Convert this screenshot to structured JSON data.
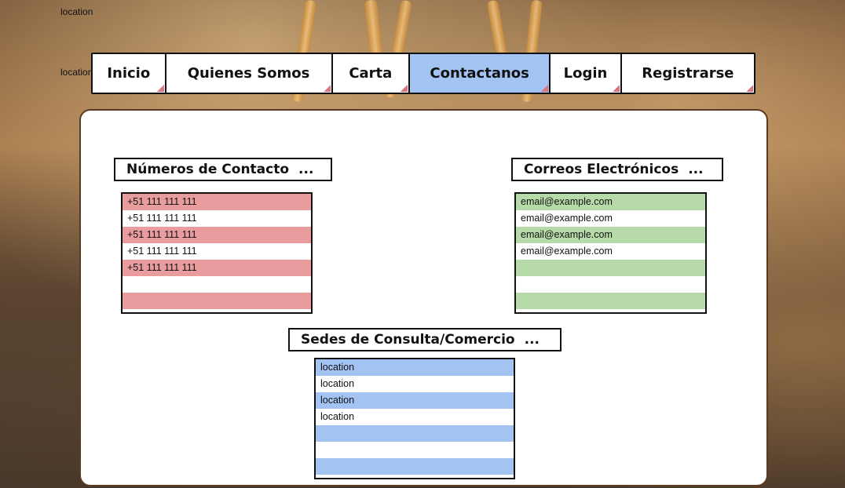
{
  "page": {
    "top_label": "location",
    "nav_label": "location"
  },
  "nav": {
    "items": [
      {
        "label": "Inicio",
        "active": false
      },
      {
        "label": "Quienes Somos",
        "active": false
      },
      {
        "label": "Carta",
        "active": false
      },
      {
        "label": "Contactanos",
        "active": true
      },
      {
        "label": "Login",
        "active": false
      },
      {
        "label": "Registrarse",
        "active": false
      }
    ],
    "active_color": "#a3c3f3"
  },
  "sections": {
    "numeros": {
      "title": "Números de Contacto",
      "more": "...",
      "stripe_color": "#e99c9d",
      "rows": [
        "+51 111 111 111",
        "+51 111 111 111",
        "+51 111 111 111",
        "+51 111 111 111",
        "+51 111 111 111",
        "",
        ""
      ]
    },
    "correos": {
      "title": "Correos Electrónicos",
      "more": "...",
      "stripe_color": "#b6dba8",
      "rows": [
        "email@example.com",
        "email@example.com",
        "email@example.com",
        "email@example.com",
        "",
        "",
        ""
      ]
    },
    "sedes": {
      "title": "Sedes de Consulta/Comercio",
      "more": "...",
      "stripe_color": "#a3c3f3",
      "rows": [
        "location",
        "location",
        "location",
        "location",
        "",
        "",
        ""
      ]
    }
  }
}
